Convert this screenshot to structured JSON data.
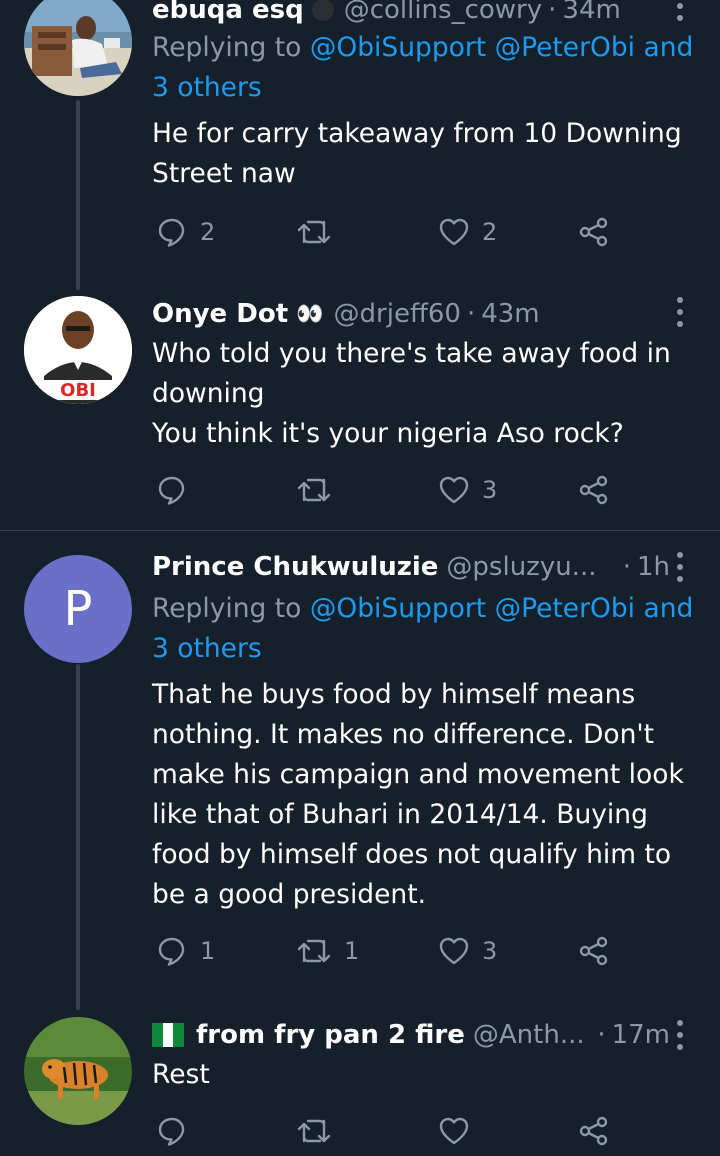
{
  "tweets": [
    {
      "name": "ebuqa esq",
      "handle": "@collins_cowry",
      "time": "34m",
      "reply_prefix": "Replying to",
      "reply_mentions": "@ObiSupport @PeterObi",
      "reply_and": "and",
      "reply_others": "3 others",
      "text": "He for carry takeaway from 10 Downing Street naw",
      "replies": "2",
      "retweets": "",
      "likes": "2"
    },
    {
      "name": "Onye Dot",
      "emoji": "👀",
      "handle": "@drjeff60",
      "time": "43m",
      "avatar_label": "OBI",
      "text": "Who told you there's take away food in downing\nYou think it's your nigeria Aso rock?",
      "replies": "",
      "retweets": "",
      "likes": "3"
    },
    {
      "name": "Prince Chukwuluzie",
      "handle": "@psluzyu...",
      "time": "1h",
      "avatar_letter": "P",
      "reply_prefix": "Replying to",
      "reply_mentions": "@ObiSupport @PeterObi",
      "reply_and": "and",
      "reply_others": "3 others",
      "text": "That he buys food by himself means nothing. It makes no difference. Don't make his campaign and movement look like that of Buhari in 2014/14. Buying food by himself does not qualify him to be a good president.",
      "replies": "1",
      "retweets": "1",
      "likes": "3"
    },
    {
      "name": "from fry pan 2 fire",
      "handle": "@Anth...",
      "time": "17m",
      "text": "Rest",
      "replies": "",
      "retweets": "",
      "likes": ""
    }
  ],
  "time_separator": "·",
  "icons": {
    "reply": "reply-icon",
    "retweet": "retweet-icon",
    "like": "heart-icon",
    "share": "share-icon",
    "more": "more-vertical-icon",
    "flag": "nigeria-flag-icon"
  },
  "colors": {
    "background": "#15202b",
    "secondary_text": "#8b98a5",
    "link": "#1d9bf0",
    "divider": "#38444d",
    "avatar_p": "#6a6fc8"
  }
}
